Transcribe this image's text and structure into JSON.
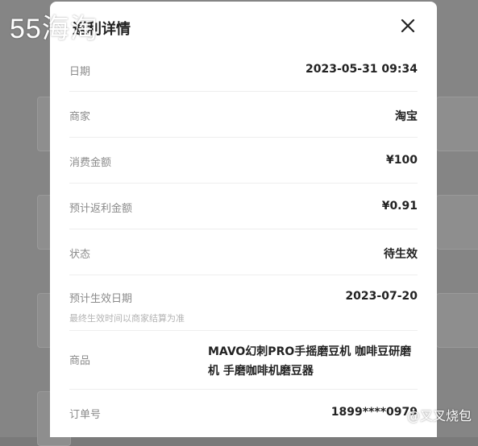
{
  "watermark": {
    "logo": "55海淘",
    "user": "@叉叉烧包"
  },
  "modal": {
    "title": "返利详情",
    "rows": [
      {
        "label": "日期",
        "value": "2023-05-31 09:34"
      },
      {
        "label": "商家",
        "value": "淘宝"
      },
      {
        "label": "消费金额",
        "value": "¥100"
      },
      {
        "label": "预计返利金额",
        "value": "¥0.91"
      },
      {
        "label": "状态",
        "value": "待生效"
      },
      {
        "label": "预计生效日期",
        "value": "2023-07-20",
        "sublabel": "最终生效时间以商家结算为准"
      },
      {
        "label": "商品",
        "value": "MAVO幻刺PRO手摇磨豆机 咖啡豆研磨机 手磨咖啡机磨豆器"
      },
      {
        "label": "订单号",
        "value": "1899****0979"
      }
    ]
  }
}
